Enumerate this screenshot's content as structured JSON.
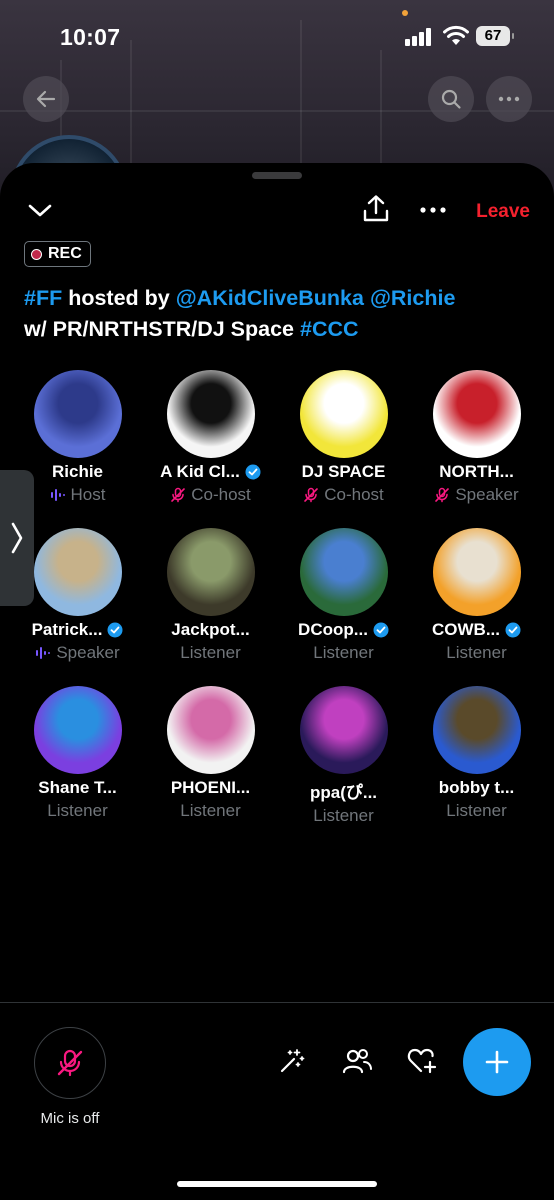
{
  "status_bar": {
    "time": "10:07",
    "battery": "67"
  },
  "space": {
    "rec_label": "REC",
    "leave_label": "Leave",
    "title": {
      "tag1": "#FF",
      "text1": " hosted by ",
      "mention1": "@AKidCliveBunka",
      "text2": " ",
      "mention2": "@Richie",
      "text3": "w/ PR/NRTHSTR/DJ Space ",
      "tag2": "#CCC"
    }
  },
  "participants": [
    {
      "name": "Richie",
      "role": "Host",
      "verified": false,
      "role_icon": "speaking-bars-icon",
      "colors": [
        "#5b6fd6",
        "#2d3a8a"
      ]
    },
    {
      "name": "A Kid Cl...",
      "role": "Co-host",
      "verified": true,
      "role_icon": "mic-off-icon",
      "colors": [
        "#f5f5f5",
        "#111111"
      ]
    },
    {
      "name": "DJ SPACE",
      "role": "Co-host",
      "verified": false,
      "role_icon": "mic-off-icon",
      "colors": [
        "#f2e63a",
        "#ffffff"
      ]
    },
    {
      "name": "NORTH...",
      "role": "Speaker",
      "verified": false,
      "role_icon": "mic-off-icon",
      "colors": [
        "#ffffff",
        "#c8202b"
      ]
    },
    {
      "name": "Patrick...",
      "role": "Speaker",
      "verified": true,
      "role_icon": "speaking-bars-icon",
      "colors": [
        "#8fb8e0",
        "#c7b28a"
      ]
    },
    {
      "name": "Jackpot...",
      "role": "Listener",
      "verified": false,
      "role_icon": "",
      "colors": [
        "#3d3a2a",
        "#8a9a6a"
      ]
    },
    {
      "name": "DCoop...",
      "role": "Listener",
      "verified": true,
      "role_icon": "",
      "colors": [
        "#2a6a3a",
        "#4a7fd0"
      ]
    },
    {
      "name": "COWB...",
      "role": "Listener",
      "verified": true,
      "role_icon": "",
      "colors": [
        "#f3a12a",
        "#e8e0d0"
      ]
    },
    {
      "name": "Shane T...",
      "role": "Listener",
      "verified": false,
      "role_icon": "",
      "colors": [
        "#7b3fe0",
        "#2a8fe0"
      ]
    },
    {
      "name": "PHOENI...",
      "role": "Listener",
      "verified": false,
      "role_icon": "",
      "colors": [
        "#f2f2f2",
        "#d46aa8"
      ]
    },
    {
      "name": "ppa(ぴ...",
      "role": "Listener",
      "verified": false,
      "role_icon": "",
      "colors": [
        "#2a1a5a",
        "#c040c0"
      ]
    },
    {
      "name": "bobby t...",
      "role": "Listener",
      "verified": false,
      "role_icon": "",
      "colors": [
        "#2a5ad0",
        "#5a4a2a"
      ]
    }
  ],
  "bottom_bar": {
    "mic_label": "Mic is off"
  },
  "colors": {
    "accent": "#1d9bf0",
    "leave": "#f4212e",
    "mic_off": "#f91880",
    "speaking": "#7856ff"
  }
}
